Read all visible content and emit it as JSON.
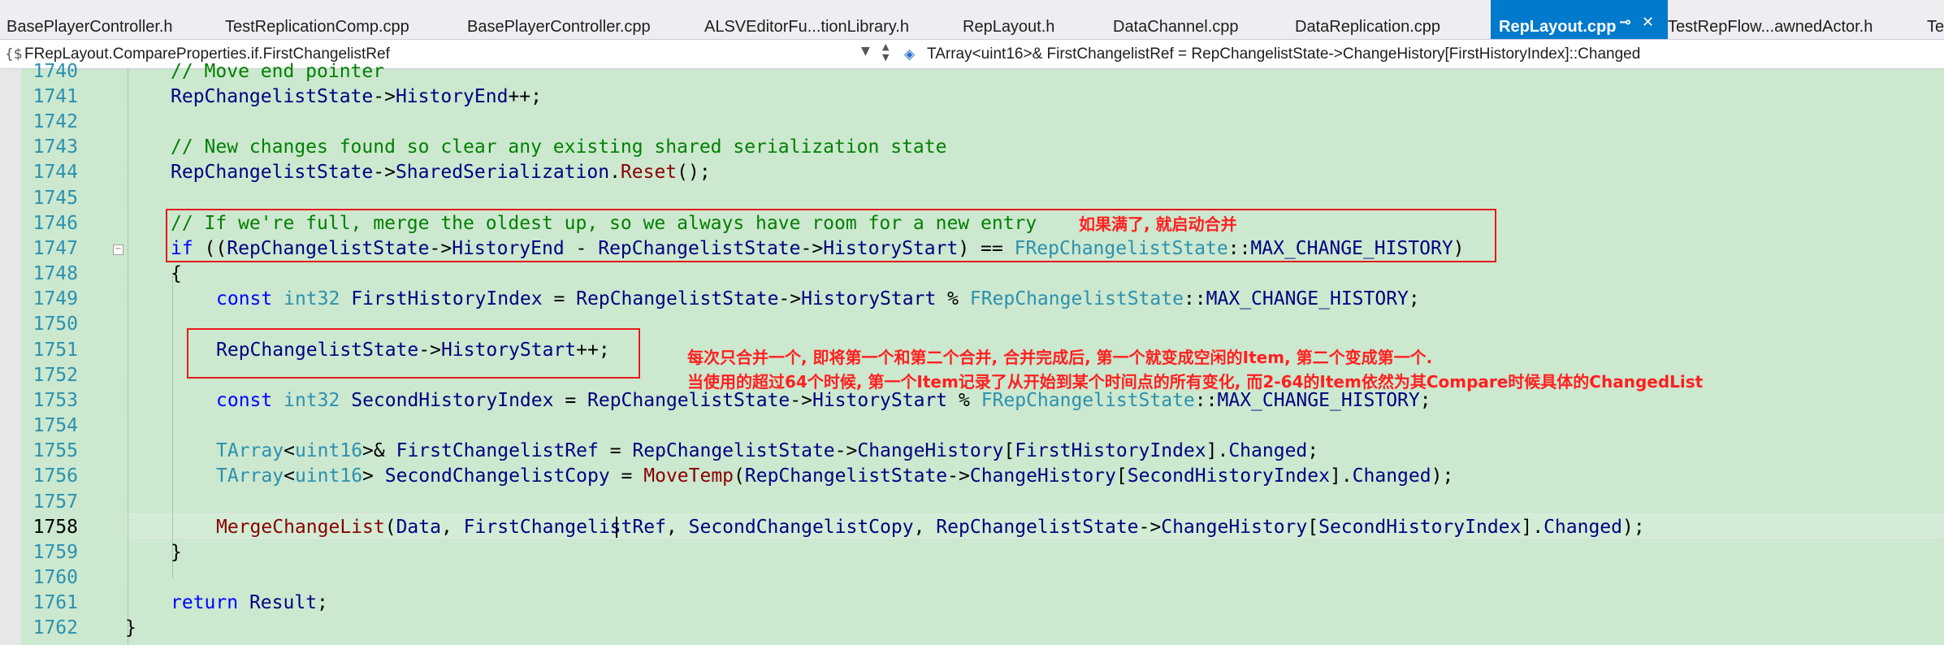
{
  "tabs": [
    {
      "label": "BasePlayerController.h"
    },
    {
      "label": "TestReplicationComp.cpp"
    },
    {
      "label": "BasePlayerController.cpp"
    },
    {
      "label": "ALSVEditorFu...tionLibrary.h"
    },
    {
      "label": "RepLayout.h"
    },
    {
      "label": "DataChannel.cpp"
    },
    {
      "label": "DataReplication.cpp"
    },
    {
      "label": "RepLayout.cpp",
      "active": true
    },
    {
      "label": "TestRepFlow...awnedActor.h"
    },
    {
      "label": "Te"
    }
  ],
  "navbar": {
    "scope": "FRepLayout.CompareProperties.if.FirstChangelistRef",
    "member": "TArray<uint16>& FirstChangelistRef = RepChangelistState->ChangeHistory[FirstHistoryIndex]::Changed"
  },
  "lines": [
    {
      "num": "1740",
      "text": "// Move end pointer"
    },
    {
      "num": "1741",
      "text": "RepChangelistState->HistoryEnd++;"
    },
    {
      "num": "1742",
      "text": ""
    },
    {
      "num": "1743",
      "text": "// New changes found so clear any existing shared serialization state"
    },
    {
      "num": "1744",
      "text": "RepChangelistState->SharedSerialization.Reset();"
    },
    {
      "num": "1745",
      "text": ""
    },
    {
      "num": "1746",
      "text": "// If we're full, merge the oldest up, so we always have room for a new entry"
    },
    {
      "num": "1747",
      "text": "if ((RepChangelistState->HistoryEnd - RepChangelistState->HistoryStart) == FRepChangelistState::MAX_CHANGE_HISTORY)"
    },
    {
      "num": "1748",
      "text": "{"
    },
    {
      "num": "1749",
      "text": "const int32 FirstHistoryIndex = RepChangelistState->HistoryStart % FRepChangelistState::MAX_CHANGE_HISTORY;"
    },
    {
      "num": "1750",
      "text": ""
    },
    {
      "num": "1751",
      "text": "RepChangelistState->HistoryStart++;"
    },
    {
      "num": "1752",
      "text": ""
    },
    {
      "num": "1753",
      "text": "const int32 SecondHistoryIndex = RepChangelistState->HistoryStart % FRepChangelistState::MAX_CHANGE_HISTORY;"
    },
    {
      "num": "1754",
      "text": ""
    },
    {
      "num": "1755",
      "text": "TArray<uint16>& FirstChangelistRef = RepChangelistState->ChangeHistory[FirstHistoryIndex].Changed;"
    },
    {
      "num": "1756",
      "text": "TArray<uint16> SecondChangelistCopy = MoveTemp(RepChangelistState->ChangeHistory[SecondHistoryIndex].Changed);"
    },
    {
      "num": "1757",
      "text": ""
    },
    {
      "num": "1758",
      "text": "MergeChangeList(Data, FirstChangelistRef, SecondChangelistCopy, RepChangelistState->ChangeHistory[SecondHistoryIndex].Changed);"
    },
    {
      "num": "1759",
      "text": "}"
    },
    {
      "num": "1760",
      "text": ""
    },
    {
      "num": "1761",
      "text": "return Result;"
    },
    {
      "num": "1762",
      "text": "}"
    }
  ],
  "annotations": {
    "note1": "如果满了, 就启动合并",
    "note2": "每次只合并一个, 即将第一个和第二个合并, 合并完成后, 第一个就变成空闲的Item, 第二个变成第一个.",
    "note3": "当使用的超过64个时候, 第一个Item记录了从开始到某个时间点的所有变化, 而2-64的Item依然为其Compare时候具体的ChangedList"
  },
  "colors": {
    "editor_background": "#cce8cf",
    "keyword": "#0000ff",
    "comment": "#008000",
    "type": "#2b91af",
    "annotation": "#ff1f1f",
    "active_tab": "#007acc"
  }
}
